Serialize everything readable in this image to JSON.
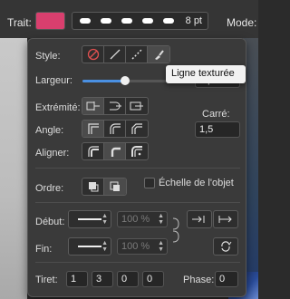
{
  "toolbar": {
    "trait_label": "Trait:",
    "stroke_color": "#d93f6e",
    "width_value": "8 pt",
    "mode_label": "Mode:"
  },
  "tooltip": {
    "text": "Ligne texturée"
  },
  "style": {
    "label": "Style:",
    "buttons": [
      "none-style-icon",
      "solid-line-icon",
      "dashed-line-icon",
      "texture-brush-icon"
    ]
  },
  "largeur": {
    "label": "Largeur:",
    "value": "8 pt"
  },
  "extremite": {
    "label": "Extrémité:"
  },
  "angle": {
    "label": "Angle:"
  },
  "aligner": {
    "label": "Aligner:"
  },
  "carre": {
    "label": "Carré:",
    "value": "1,5"
  },
  "ordre": {
    "label": "Ordre:",
    "scale_label": "Échelle de l'objet"
  },
  "debut": {
    "label": "Début:",
    "percent": "100 %"
  },
  "fin": {
    "label": "Fin:",
    "percent": "100 %"
  },
  "tiret": {
    "label": "Tiret:",
    "values": [
      "1",
      "3",
      "0",
      "0"
    ]
  },
  "phase": {
    "label": "Phase:",
    "value": "0"
  }
}
